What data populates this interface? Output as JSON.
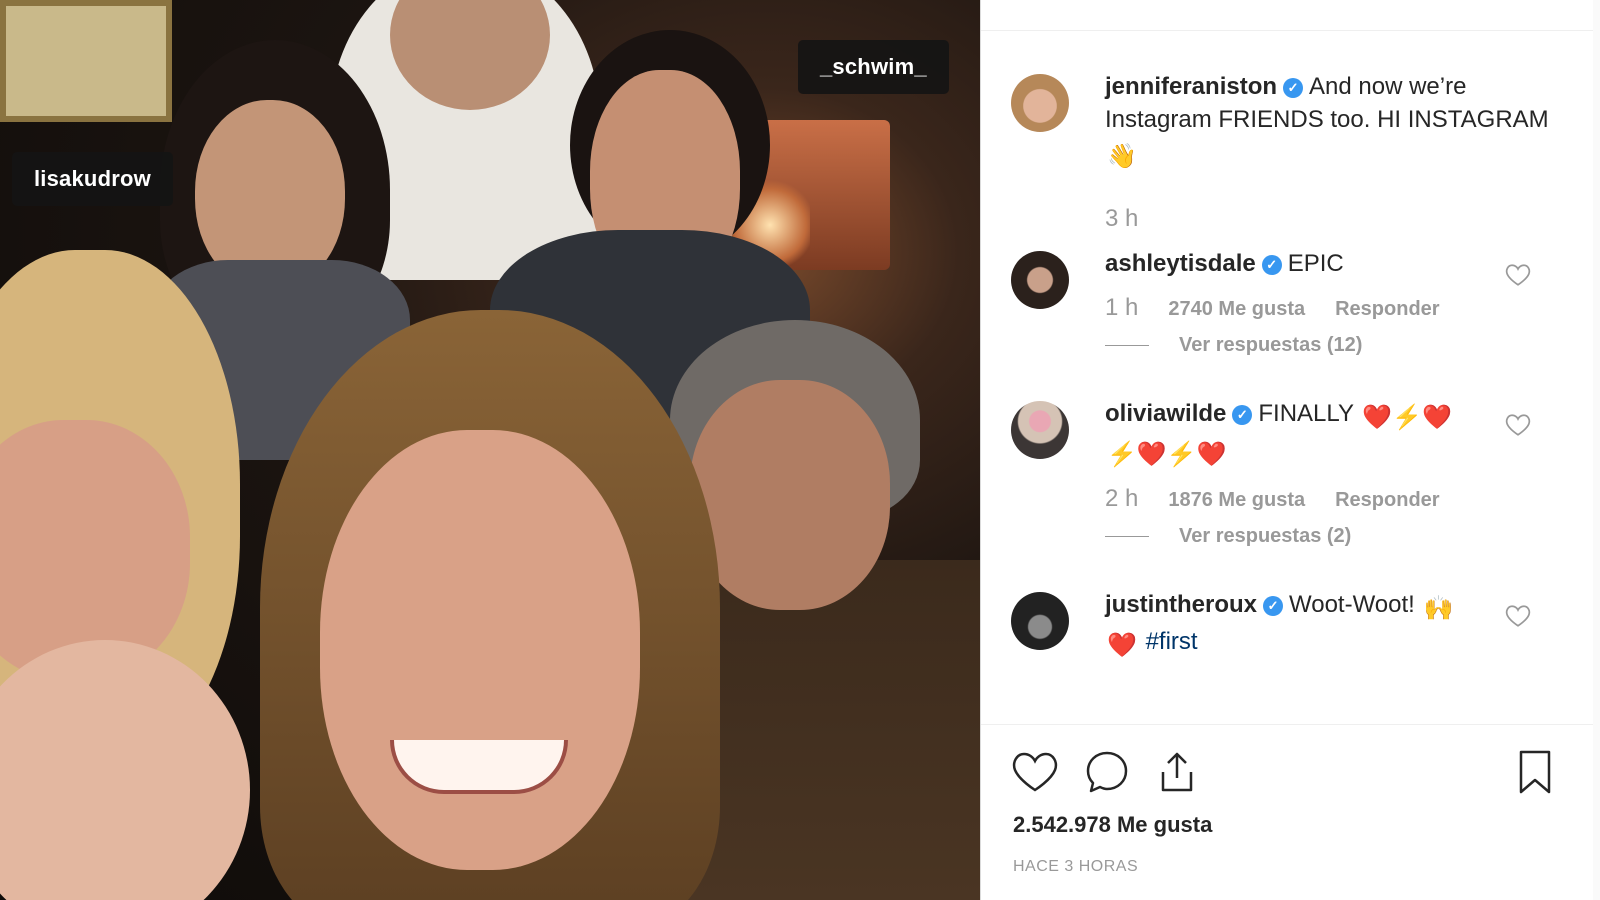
{
  "photo": {
    "tags": [
      {
        "label": "lisakudrow"
      },
      {
        "label": "_schwim_"
      }
    ]
  },
  "caption": {
    "username": "jenniferaniston",
    "text": "And now we’re Instagram FRIENDS too. HI INSTAGRAM",
    "emoji": "👋",
    "time": "3 h"
  },
  "comments": [
    {
      "username": "ashleytisdale",
      "text": "EPIC",
      "time": "1 h",
      "likes": "2740 Me gusta",
      "reply": "Responder",
      "view_replies": "Ver respuestas (12)"
    },
    {
      "username": "oliviawilde",
      "text": "FINALLY",
      "emoji_line1": "❤️⚡❤️",
      "emoji_line2": "⚡❤️⚡❤️",
      "time": "2 h",
      "likes": "1876 Me gusta",
      "reply": "Responder",
      "view_replies": "Ver respuestas (2)"
    },
    {
      "username": "justintheroux",
      "text": "Woot-Woot!",
      "emoji": "🙌",
      "hashtag": "#first"
    }
  ],
  "footer": {
    "likes_total": "2.542.978 Me gusta",
    "posted_ago": "HACE 3 HORAS"
  },
  "colors": {
    "verified": "#3897f0",
    "heart": "#e0245e",
    "text": "#262626",
    "muted": "#999999"
  },
  "icons": [
    "heart-icon",
    "comment-icon",
    "share-icon",
    "bookmark-icon",
    "verified-badge-icon",
    "small-heart-icon"
  ]
}
